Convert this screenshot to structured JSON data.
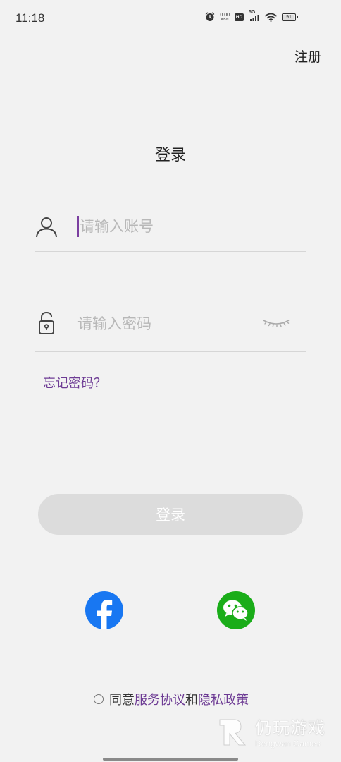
{
  "status_bar": {
    "time": "11:18",
    "net_speed_value": "0.00",
    "net_speed_unit": "KB/s",
    "hd_label": "HD",
    "network_type": "5G",
    "battery": "91",
    "battery_level": 0.91,
    "icons": [
      "alarm-icon",
      "hd-icon",
      "signal-icon",
      "wifi-icon",
      "battery-icon"
    ]
  },
  "header": {
    "register_label": "注册",
    "title": "登录"
  },
  "form": {
    "account_placeholder": "请输入账号",
    "password_placeholder": "请输入密码",
    "forgot_password": "忘记密码？",
    "login_button": "登录"
  },
  "social": {
    "items": [
      "facebook-icon",
      "wechat-icon"
    ]
  },
  "agreement": {
    "prefix": "同意",
    "terms": "服务协议",
    "and": "和",
    "privacy": "隐私政策"
  },
  "watermark": {
    "main": "仍玩游戏",
    "sub": "Rengwan Games"
  },
  "colors": {
    "accent": "#6d3b94",
    "background": "#f2f2f2",
    "button_disabled": "#dcdcdc",
    "facebook": "#1877f2",
    "wechat": "#1aad19"
  }
}
